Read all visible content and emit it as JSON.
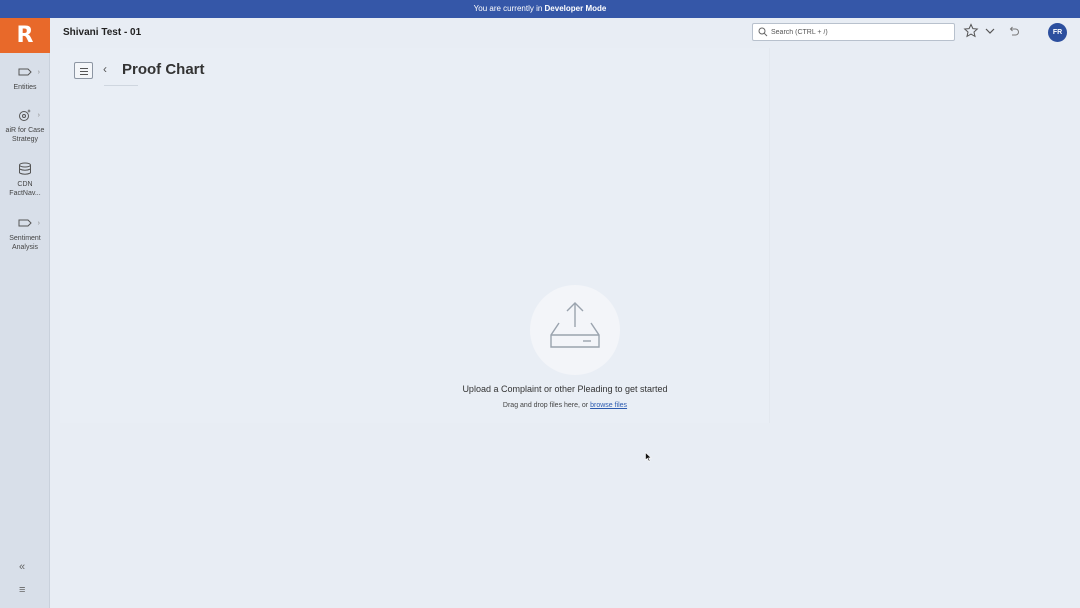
{
  "banner": {
    "prefix": "You are currently in ",
    "mode": "Developer Mode"
  },
  "logo": {
    "letter": "R"
  },
  "sidebar": {
    "items": [
      {
        "label": "Entities",
        "icon": "tag-icon"
      },
      {
        "label": "aiR for Case Strategy",
        "icon": "ai-gear-icon"
      },
      {
        "label": "CDN FactNav...",
        "icon": "database-icon"
      },
      {
        "label": "Sentiment Analysis",
        "icon": "tag-icon"
      }
    ],
    "collapse_glyph": "«",
    "menu_glyph": "≡"
  },
  "header": {
    "project_title": "Shivani Test - 01",
    "search_placeholder": "Search (CTRL + /)",
    "avatar_initials": "FR"
  },
  "page": {
    "back_glyph": "‹",
    "title": "Proof Chart"
  },
  "upload": {
    "heading": "Upload a Complaint or other Pleading to get started",
    "sub_prefix": "Drag and drop files here, or ",
    "browse_link": "browse files"
  },
  "colors": {
    "accent": "#e8692a",
    "banner": "#3557a8",
    "avatar": "#2c4f9e",
    "link": "#2c5bb0"
  }
}
